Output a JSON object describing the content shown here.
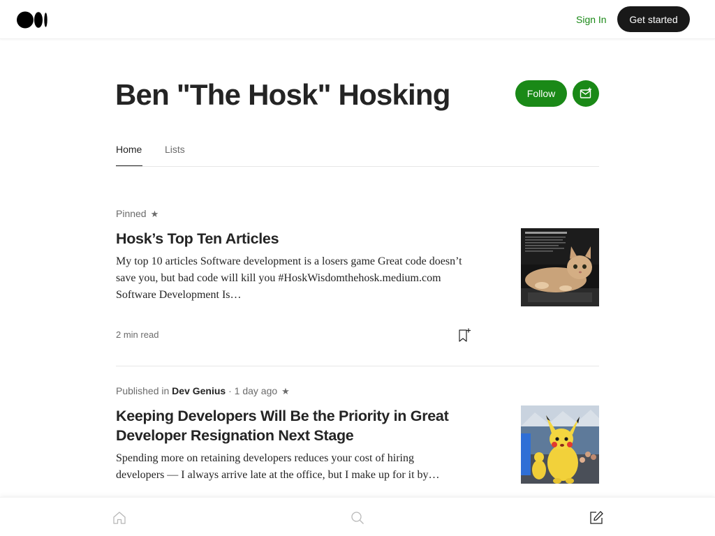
{
  "nav": {
    "logo_icon": "medium-logo-icon",
    "signin_label": "Sign In",
    "get_started_label": "Get started"
  },
  "header": {
    "author_name": "Ben \"The Hosk\" Hosking",
    "follow_label": "Follow",
    "subscribe_icon": "mail-plus-icon"
  },
  "tabs": [
    {
      "label": "Home",
      "active": true
    },
    {
      "label": "Lists",
      "active": false
    }
  ],
  "articles": [
    {
      "pinned_label": "Pinned",
      "title": "Hosk’s Top Ten Articles",
      "subtitle": "My top 10 articles Software development is a losers game Great code doesn’t save you, but bad code will kill you #HoskWisdomthehosk.medium.com Software Development Is…",
      "read_time": "2 min read",
      "image": "cat-on-laptop-thumbnail"
    },
    {
      "published_prefix": "Published in",
      "publication": "Dev Genius",
      "age": "· 1 day ago",
      "title": "Keeping Developers Will Be the Priority in Great Developer Resignation Next Stage",
      "subtitle": "Spending more on retaining developers reduces your cost of hiring developers — I always arrive late at the office, but I make up for it by…",
      "image": "pikachu-costume-thumbnail"
    }
  ],
  "colors": {
    "accent_green": "#1a8917",
    "text_primary": "#242424",
    "text_secondary": "#6b6b6b",
    "dark_button": "#191919"
  },
  "bottom_bar": {
    "icons": [
      "home-icon",
      "search-icon",
      "write-icon"
    ]
  }
}
